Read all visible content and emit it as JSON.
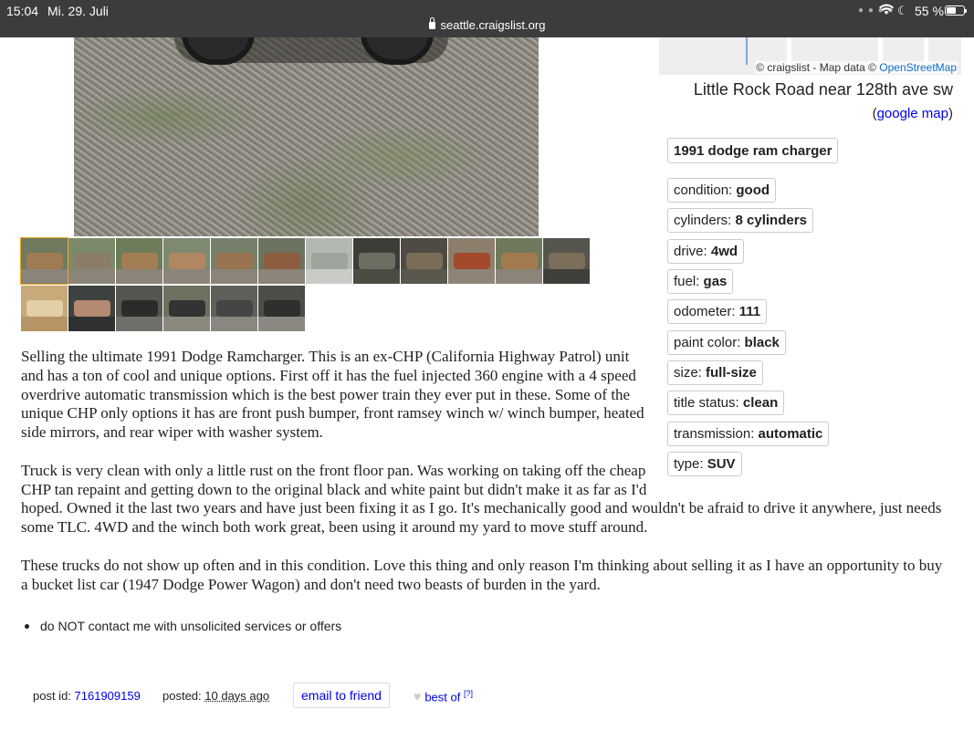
{
  "status_bar": {
    "time": "15:04",
    "date": "Mi. 29. Juli",
    "url": "seattle.craigslist.org",
    "battery": "55 %",
    "battery_level": 0.55
  },
  "map": {
    "attribution_prefix": "© craigslist - Map data ©",
    "attribution_link": "OpenStreetMap",
    "address": "Little Rock Road near 128th ave sw",
    "google_map_open": "(",
    "google_map_link": "google map",
    "google_map_close": ")"
  },
  "title_attr": "1991 dodge ram charger",
  "attributes": [
    {
      "label": "condition: ",
      "value": "good"
    },
    {
      "label": "cylinders: ",
      "value": "8 cylinders"
    },
    {
      "label": "drive: ",
      "value": "4wd"
    },
    {
      "label": "fuel: ",
      "value": "gas"
    },
    {
      "label": "odometer: ",
      "value": "111"
    },
    {
      "label": "paint color: ",
      "value": "black"
    },
    {
      "label": "size: ",
      "value": "full-size"
    },
    {
      "label": "title status: ",
      "value": "clean"
    },
    {
      "label": "transmission: ",
      "value": "automatic"
    },
    {
      "label": "type: ",
      "value": "SUV"
    }
  ],
  "body": {
    "para1": "Selling the ultimate 1991 Dodge Ramcharger. This is an ex-CHP (California Highway Patrol) unit and has a ton of cool and unique options. First off it has the fuel injected 360 engine with a 4 speed overdrive automatic transmission which is the best power train they ever put in these. Some of the unique CHP only options it has are front push bumper, front ramsey winch w/ winch bumper, heated side mirrors, and rear wiper with washer system.",
    "para2_line1": "Truck is very clean with only a little rust on the front floor pan. Was working on taking off the cheap",
    "para2_line2": "CHP tan repaint and getting down to the original black and white paint but didn't make it as far as I'd",
    "para2_rest": "hoped. Owned it the last two years and have just been fixing it as I go. It's mechanically good and wouldn't be afraid to drive it anywhere, just needs some TLC. 4WD and the winch both work great, been using it around my yard to move stuff around.",
    "para3": "These trucks do not show up often and in this condition. Love this thing and only reason I'm thinking about selling it as I have an opportunity to buy a bucket list car (1947 Dodge Power Wagon) and don't need two beasts of burden in the yard."
  },
  "notices": [
    "do NOT contact me with unsolicited services or offers"
  ],
  "footer": {
    "post_id_label": "post id: ",
    "post_id": "7161909159",
    "posted_label": "posted: ",
    "posted_value": "10 days ago",
    "email_label": "email to friend",
    "best_of_label": "best of",
    "best_of_help": "[?]",
    "heart_icon": "heart-icon"
  },
  "thumbnails_count": 18,
  "colors": {
    "link": "#0000ee",
    "selected_thumb_border": "#f3a324",
    "status_bar_bg": "#3c3c3c",
    "attribution_link": "#0c6ecd"
  }
}
